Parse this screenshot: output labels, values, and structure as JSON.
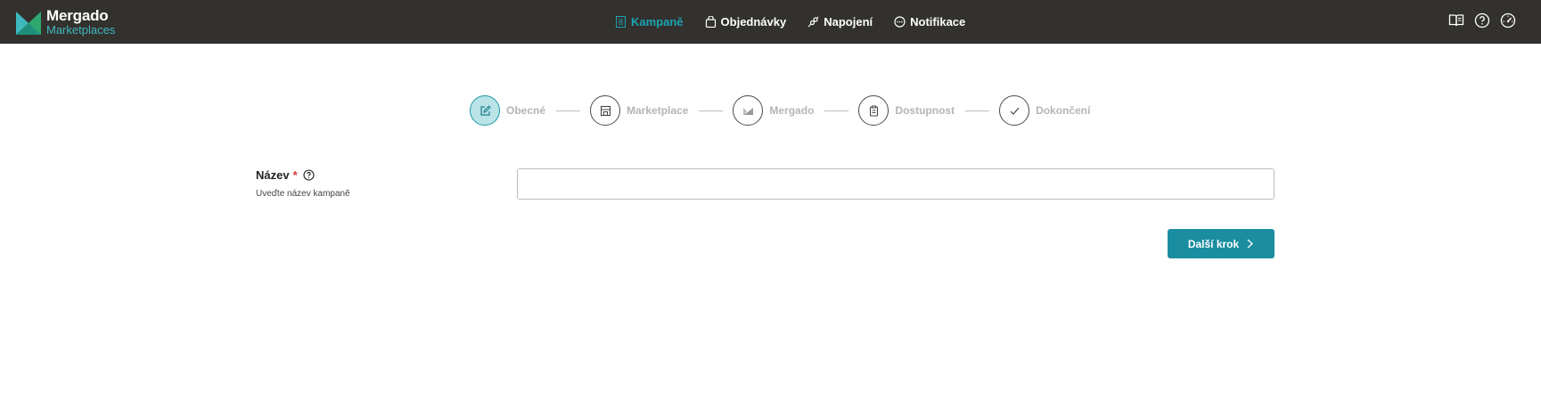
{
  "app": {
    "logo_title": "Mergado",
    "logo_subtitle": "Marketplaces",
    "brand_colors": {
      "dark": "#33312e",
      "accent": "#1aa3b2",
      "button": "#1a8ea0"
    }
  },
  "nav": {
    "items": [
      {
        "label": "Kampaně",
        "icon": "document-icon",
        "active": true
      },
      {
        "label": "Objednávky",
        "icon": "bag-icon",
        "active": false
      },
      {
        "label": "Napojení",
        "icon": "plug-icon",
        "active": false
      },
      {
        "label": "Notifikace",
        "icon": "chat-icon",
        "active": false
      }
    ]
  },
  "top_icons": [
    "book-icon",
    "help-icon",
    "dashboard-icon"
  ],
  "stepper": {
    "steps": [
      {
        "label": "Obecné",
        "icon": "edit-icon",
        "active": true
      },
      {
        "label": "Marketplace",
        "icon": "store-icon",
        "active": false
      },
      {
        "label": "Mergado",
        "icon": "mergado-icon",
        "active": false
      },
      {
        "label": "Dostupnost",
        "icon": "clipboard-icon",
        "active": false
      },
      {
        "label": "Dokončení",
        "icon": "check-icon",
        "active": false
      }
    ]
  },
  "form": {
    "name_label": "Název",
    "required_mark": "*",
    "name_hint": "Uveďte název kampaně",
    "name_value": ""
  },
  "actions": {
    "next_label": "Další krok"
  }
}
